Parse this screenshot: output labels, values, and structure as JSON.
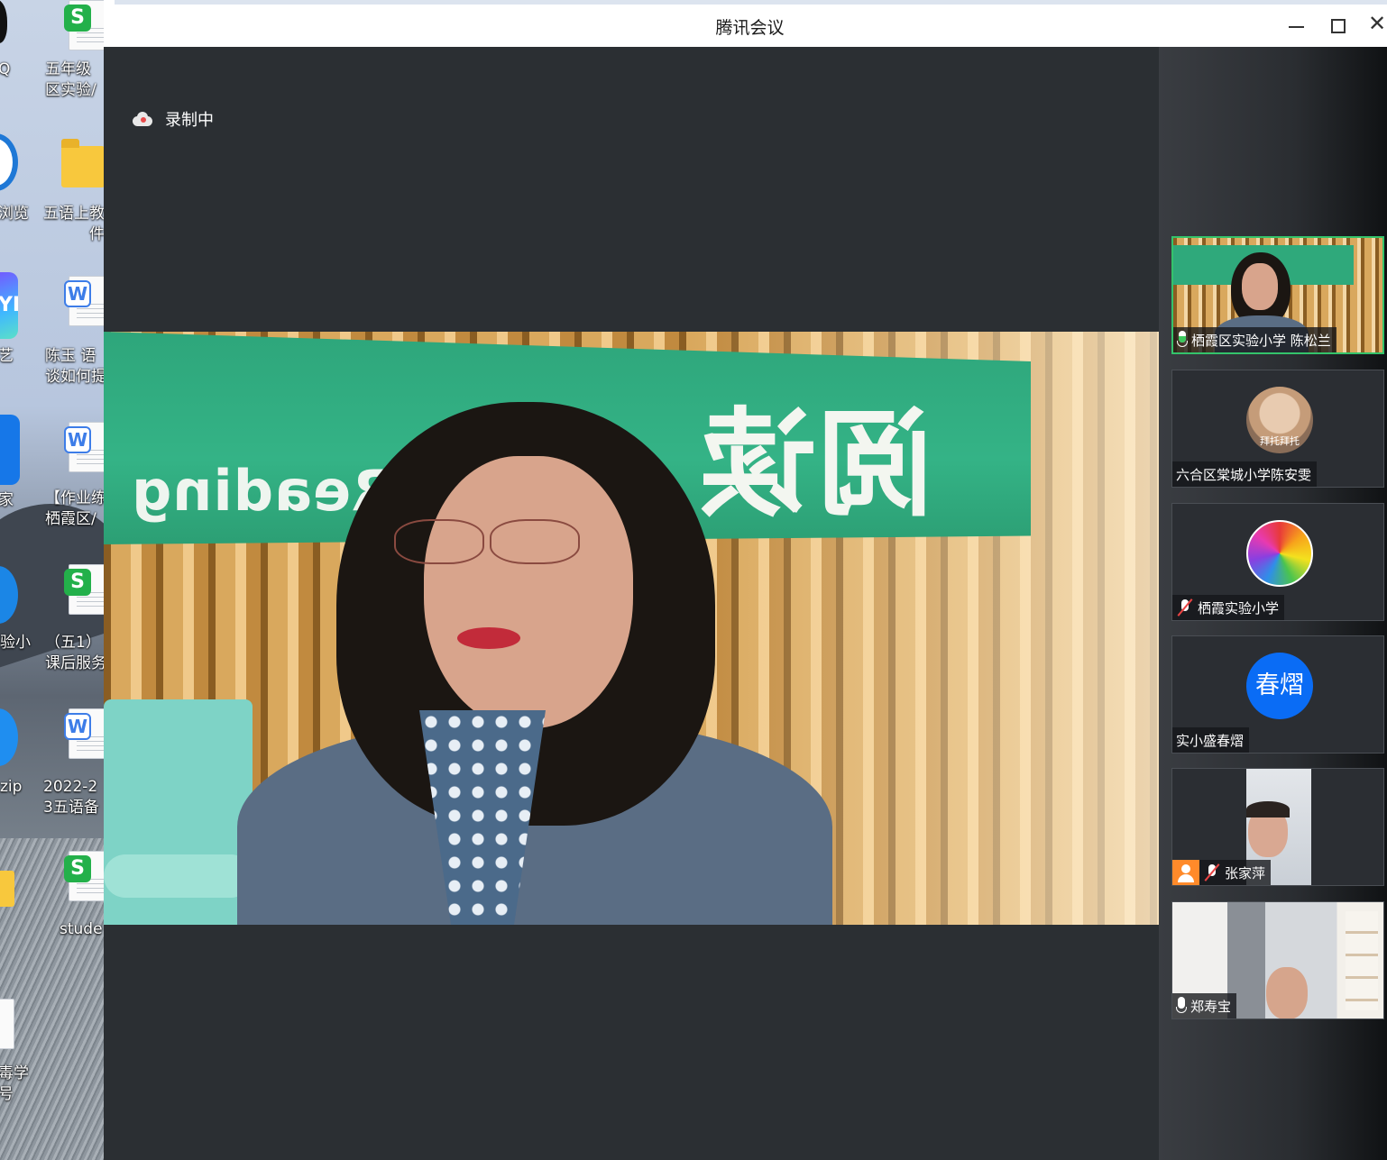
{
  "desktop": {
    "icons": [
      {
        "label": "Q"
      },
      {
        "label": "五年级\n区实验/"
      },
      {
        "label": "浏览"
      },
      {
        "label": "五语上教\n件"
      },
      {
        "label": "艺"
      },
      {
        "label": "陈玉 语\n谈如何提"
      },
      {
        "label": "家"
      },
      {
        "label": "【作业练\n栖霞区/"
      },
      {
        "label": "验小"
      },
      {
        "label": "（五1）\n课后服务"
      },
      {
        "label": "zip"
      },
      {
        "label": "2022-2\n3五语备"
      },
      {
        "label": "stude"
      },
      {
        "label": "毒学\n号"
      }
    ],
    "badge_s": "S",
    "badge_w": "W",
    "app_text_yi": "YI"
  },
  "window": {
    "title": "腾讯会议",
    "controls": {
      "minimize": "minimize",
      "maximize": "maximize",
      "close": "✕"
    }
  },
  "recording": {
    "label": "录制中",
    "icon": "cloud-record-icon"
  },
  "main_video": {
    "sign_english": "Reading",
    "sign_chinese": "阅读"
  },
  "participants": [
    {
      "name": "栖霞区实验小学 陈松兰",
      "mic": "on",
      "active": true,
      "type": "video"
    },
    {
      "name": "六合区棠城小学陈安雯",
      "mic": "none",
      "active": false,
      "type": "avatar",
      "avatar_caption": "拜托拜托"
    },
    {
      "name": "栖霞实验小学",
      "mic": "off",
      "active": false,
      "type": "avatar"
    },
    {
      "name": "实小盛春熠",
      "mic": "none",
      "active": false,
      "type": "text-avatar",
      "avatar_text": "春熠"
    },
    {
      "name": "张家萍",
      "mic": "off",
      "active": false,
      "type": "video"
    },
    {
      "name": "郑寿宝",
      "mic": "on",
      "active": false,
      "type": "video"
    }
  ]
}
